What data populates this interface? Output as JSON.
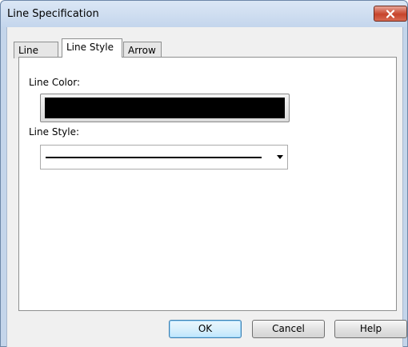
{
  "window": {
    "title": "Line Specification",
    "close_icon": "close-icon"
  },
  "tabs": [
    {
      "label": "Line",
      "active": false
    },
    {
      "label": "Line Style",
      "active": true
    },
    {
      "label": "Arrow",
      "active": false
    }
  ],
  "line_style_panel": {
    "line_color_label": "Line Color:",
    "line_color_value": "#000000",
    "line_style_label": "Line Style:",
    "line_style_value": "solid",
    "dropdown_icon": "chevron-down-icon"
  },
  "buttons": {
    "ok": "OK",
    "cancel": "Cancel",
    "help": "Help"
  },
  "colors": {
    "title_bar": "#c3d5ec",
    "close_button": "#c7432b",
    "default_button_border": "#3c7fb1"
  }
}
